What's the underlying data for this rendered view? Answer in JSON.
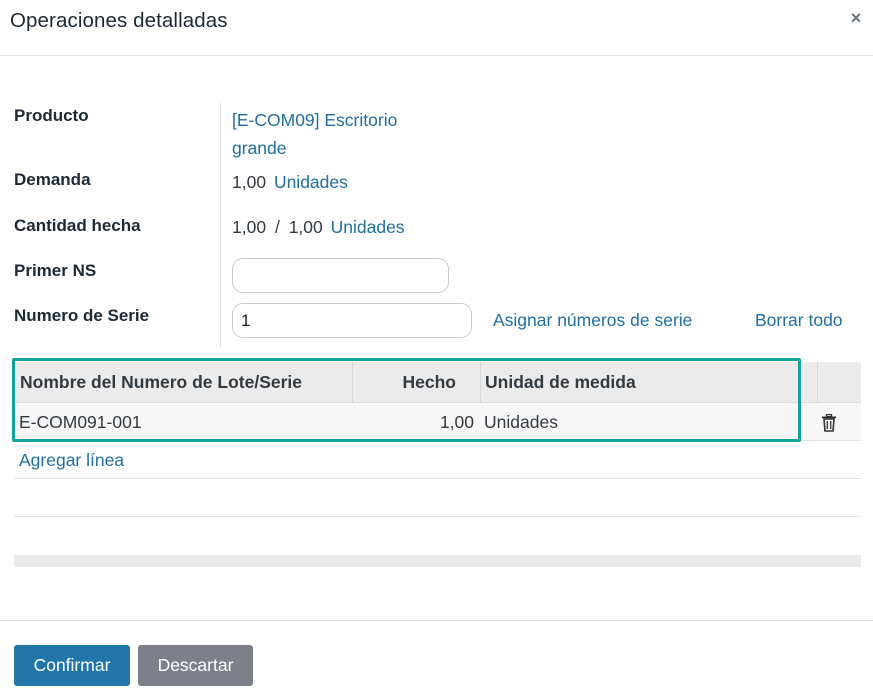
{
  "dialog": {
    "title": "Operaciones detalladas",
    "close_symbol": "×"
  },
  "form": {
    "product_label": "Producto",
    "product_value_line1": "[E-COM09] Escritorio",
    "product_value_line2": "grande",
    "demand_label": "Demanda",
    "demand_qty": "1,00",
    "demand_uom": "Unidades",
    "qty_done_label": "Cantidad hecha",
    "qty_done": "1,00",
    "qty_separator": "/",
    "qty_total": "1,00",
    "qty_uom": "Unidades",
    "first_sn_label": "Primer NS",
    "first_sn_value": "",
    "serial_count_label": "Numero de Serie",
    "serial_count_value": "1",
    "assign_serials_link": "Asignar números de serie",
    "clear_all_link": "Borrar todo"
  },
  "table": {
    "columns": [
      "Nombre del Numero de Lote/Serie",
      "Hecho",
      "Unidad de medida"
    ],
    "rows": [
      {
        "lot": "E-COM091-001",
        "done": "1,00",
        "uom": "Unidades"
      }
    ],
    "add_line_label": "Agregar línea"
  },
  "footer": {
    "confirm_label": "Confirmar",
    "discard_label": "Descartar"
  },
  "colors": {
    "primary": "#2175a9",
    "secondary": "#7d8089",
    "link": "#1f6fa3",
    "highlight": "#14a39b"
  },
  "icons": {
    "close": "close-icon",
    "delete_row": "trash-icon"
  }
}
